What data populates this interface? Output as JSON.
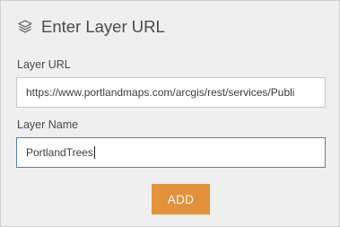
{
  "header": {
    "icon": "layers-icon",
    "title": "Enter Layer URL"
  },
  "form": {
    "url_label": "Layer URL",
    "url_value": "https://www.portlandmaps.com/arcgis/rest/services/Publi",
    "name_label": "Layer Name",
    "name_value": "PortlandTrees",
    "add_label": "ADD"
  },
  "colors": {
    "panel_background": "#efefef",
    "add_button": "#e3913a",
    "focused_border": "#5a7fa6"
  }
}
